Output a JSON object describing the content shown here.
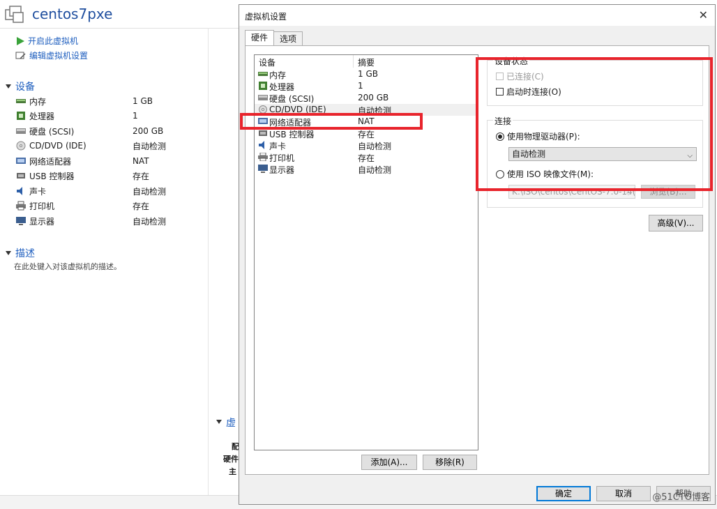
{
  "app": {
    "vm_name": "centos7pxe"
  },
  "commands": [
    {
      "label": "开启此虚拟机",
      "icon": "play-icon"
    },
    {
      "label": "编辑虚拟机设置",
      "icon": "edit-settings-icon"
    }
  ],
  "devices_section": {
    "title": "设备",
    "items": [
      {
        "name": "内存",
        "value": "1 GB",
        "icon": "memory-icon"
      },
      {
        "name": "处理器",
        "value": "1",
        "icon": "processor-icon"
      },
      {
        "name": "硬盘 (SCSI)",
        "value": "200 GB",
        "icon": "hard-disk-icon"
      },
      {
        "name": "CD/DVD (IDE)",
        "value": "自动检测",
        "icon": "cd-dvd-icon"
      },
      {
        "name": "网络适配器",
        "value": "NAT",
        "icon": "network-adapter-icon"
      },
      {
        "name": "USB 控制器",
        "value": "存在",
        "icon": "usb-icon"
      },
      {
        "name": "声卡",
        "value": "自动检测",
        "icon": "sound-icon"
      },
      {
        "name": "打印机",
        "value": "存在",
        "icon": "printer-icon"
      },
      {
        "name": "显示器",
        "value": "自动检测",
        "icon": "display-icon"
      }
    ]
  },
  "description_section": {
    "title": "描述",
    "hint": "在此处键入对该虚拟机的描述。"
  },
  "background_bottom": {
    "section_partial": "虚",
    "line1": "配",
    "line2": "硬件",
    "line3": "主"
  },
  "dialog": {
    "title": "虚拟机设置",
    "close_glyph": "✕",
    "tabs": [
      {
        "label": "硬件",
        "active": true
      },
      {
        "label": "选项",
        "active": false
      }
    ],
    "device_list": {
      "col_device": "设备",
      "col_summary": "摘要",
      "rows": [
        {
          "name": "内存",
          "value": "1 GB",
          "icon": "memory-icon"
        },
        {
          "name": "处理器",
          "value": "1",
          "icon": "processor-icon"
        },
        {
          "name": "硬盘 (SCSI)",
          "value": "200 GB",
          "icon": "hard-disk-icon"
        },
        {
          "name": "CD/DVD (IDE)",
          "value": "自动检测",
          "icon": "cd-dvd-icon",
          "selected": true
        },
        {
          "name": "网络适配器",
          "value": "NAT",
          "icon": "network-adapter-icon"
        },
        {
          "name": "USB 控制器",
          "value": "存在",
          "icon": "usb-icon"
        },
        {
          "name": "声卡",
          "value": "自动检测",
          "icon": "sound-icon"
        },
        {
          "name": "打印机",
          "value": "存在",
          "icon": "printer-icon"
        },
        {
          "name": "显示器",
          "value": "自动检测",
          "icon": "display-icon"
        }
      ]
    },
    "add_button": "添加(A)...",
    "remove_button": "移除(R)",
    "device_status": {
      "title": "设备状态",
      "connected": "已连接(C)",
      "connect_at_power_on": "启动时连接(O)"
    },
    "connection": {
      "title": "连接",
      "use_physical": "使用物理驱动器(P):",
      "physical_selected": "自动检测",
      "use_iso": "使用 ISO 映像文件(M):",
      "iso_path": "K:\\ISO\\centos\\CentOS-7.0-14(",
      "browse": "浏览(B)..."
    },
    "advanced_button": "高级(V)...",
    "ok_button": "确定",
    "cancel_button": "取消",
    "help_button": "帮助"
  },
  "watermark": "@51CTO博客",
  "colors": {
    "highlight": "#e8242c",
    "accent": "#1f5fbf",
    "title_blue": "#1f4e9e"
  }
}
